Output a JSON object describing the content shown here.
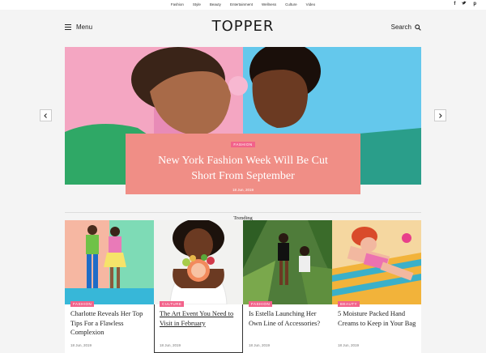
{
  "top_nav": [
    "Fashion",
    "Style",
    "Beauty",
    "Entertainment",
    "Wellness",
    "Culture",
    "Video"
  ],
  "social": [
    "f",
    "t",
    "p"
  ],
  "header": {
    "menu_label": "Menu",
    "logo": "TOPPER",
    "search_label": "Search"
  },
  "hero": {
    "category": "Fashion",
    "title_line1": "New York Fashion Week Will Be Cut",
    "title_line2": "Short From September",
    "date": "18 Jun, 2019",
    "colors": {
      "left_bg": "#f4a6c2",
      "right_bg": "#64c8ec",
      "card_bg": "#f08e86"
    }
  },
  "section_title": "Trending",
  "cards": [
    {
      "category": "Fashion",
      "title": "Charlotte Reveals Her Top Tips For a Flawless Complexion",
      "date": "18 Jun, 2019",
      "underlined": false
    },
    {
      "category": "Culture",
      "title": "The Art Event You Need to Visit in February",
      "date": "18 Jun, 2019",
      "underlined": true
    },
    {
      "category": "Fashion",
      "title": "Is Estella Launching Her Own Line of Accessories?",
      "date": "18 Jun, 2019",
      "underlined": false
    },
    {
      "category": "Beauty",
      "title": "5 Moisture Packed Hand Creams to Keep in Your Bag",
      "date": "18 Jun, 2019",
      "underlined": false
    }
  ],
  "accent_color": "#f2628a"
}
